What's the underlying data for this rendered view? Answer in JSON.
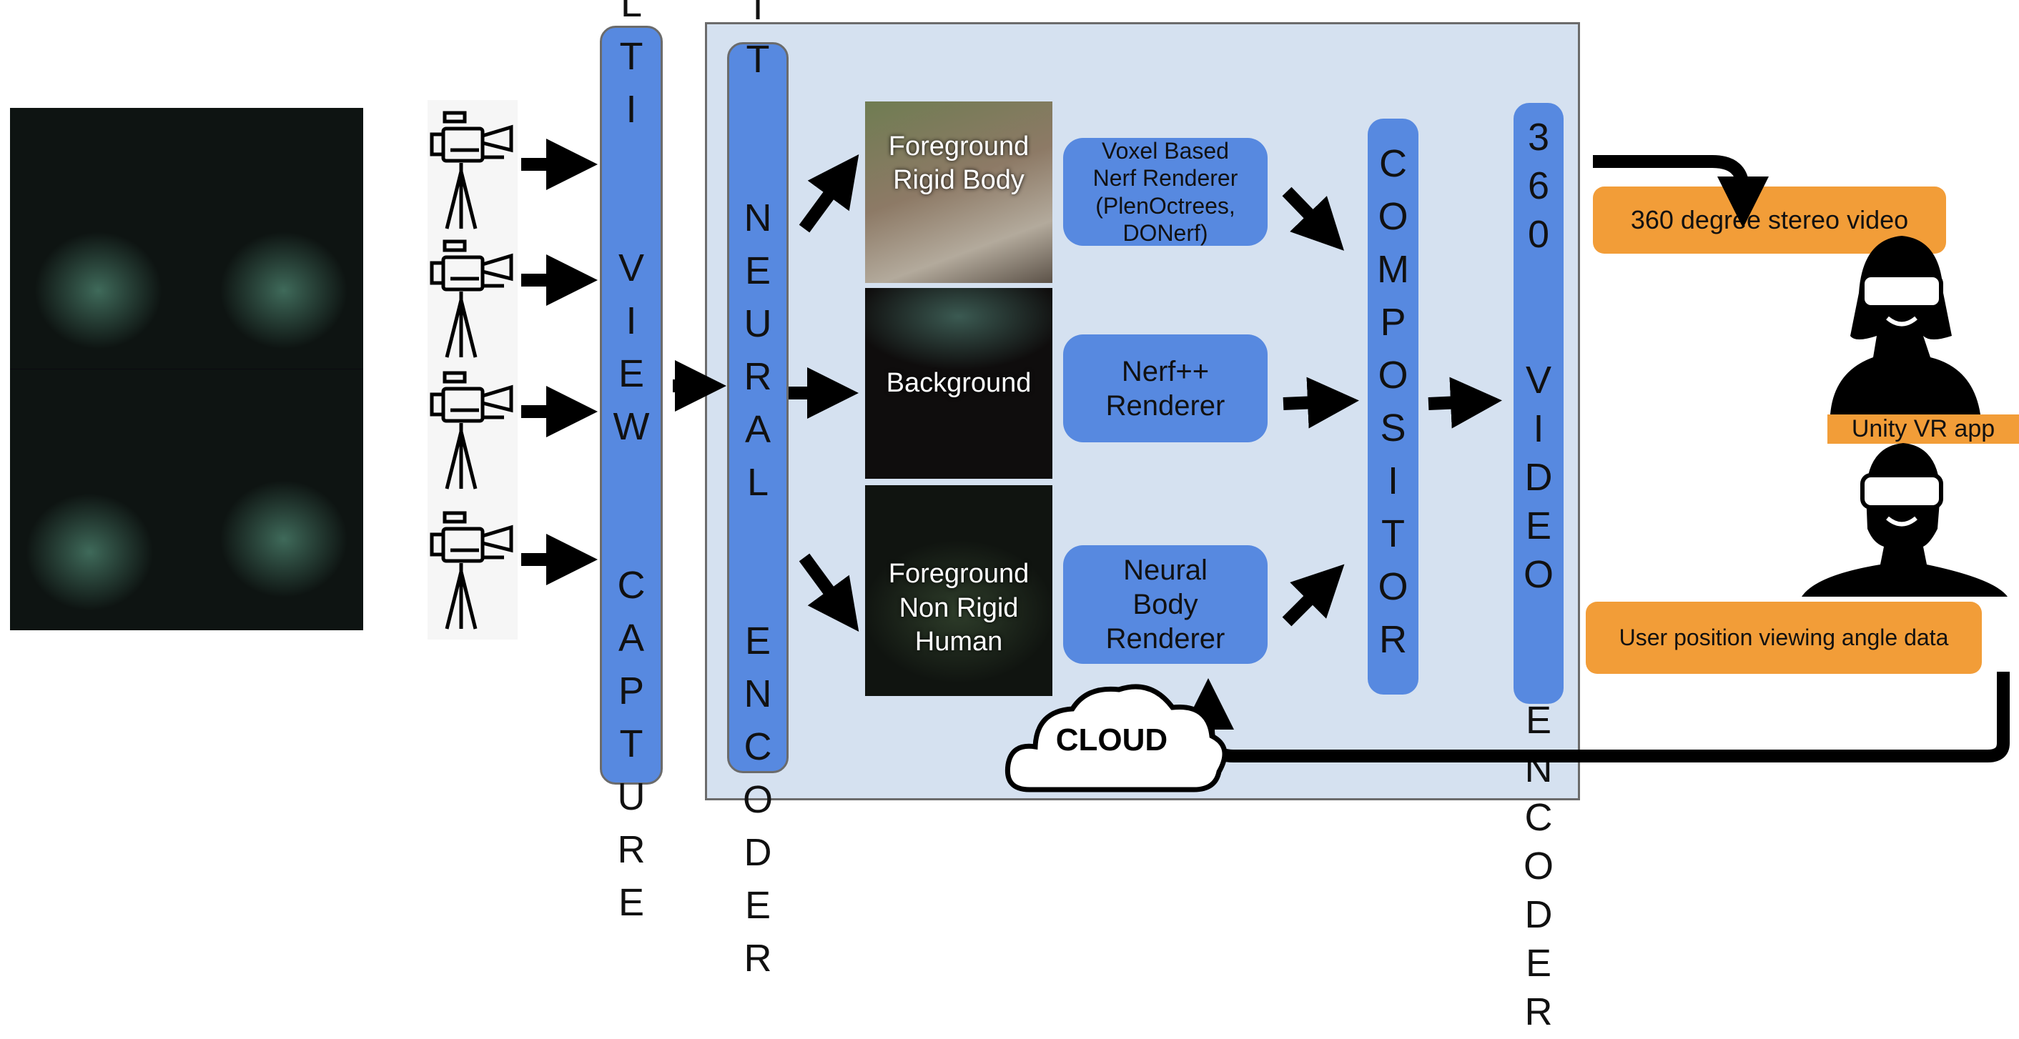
{
  "capture_label": "MULTI  VIEW  CAPTURE",
  "encoder_label": "SPLIT  NEURAL  ENCODER",
  "compositor_label": "COMPOSITOR",
  "video_encoder_label": "360  VIDEO  ENCODER",
  "cloud_label": "CLOUD",
  "segments": [
    {
      "label": "Foreground\nRigid Body"
    },
    {
      "label": "Background"
    },
    {
      "label": "Foreground\nNon Rigid\nHuman"
    }
  ],
  "renderers": [
    {
      "label": "Voxel Based\nNerf Renderer\n(PlenOctrees,\nDONerf)"
    },
    {
      "label": "Nerf++\nRenderer"
    },
    {
      "label": "Neural\nBody\nRenderer"
    }
  ],
  "output_label": "360 degree stereo video",
  "app_label": "Unity VR app",
  "feedback_label": "User position viewing angle data",
  "icons": [
    "video-camera-icon",
    "vr-headset-user-icon",
    "cloud-icon",
    "arrow-icon"
  ],
  "colors": {
    "block_blue": "#5789e0",
    "cloud_bg": "#d5e1f0",
    "orange": "#f29d38"
  }
}
